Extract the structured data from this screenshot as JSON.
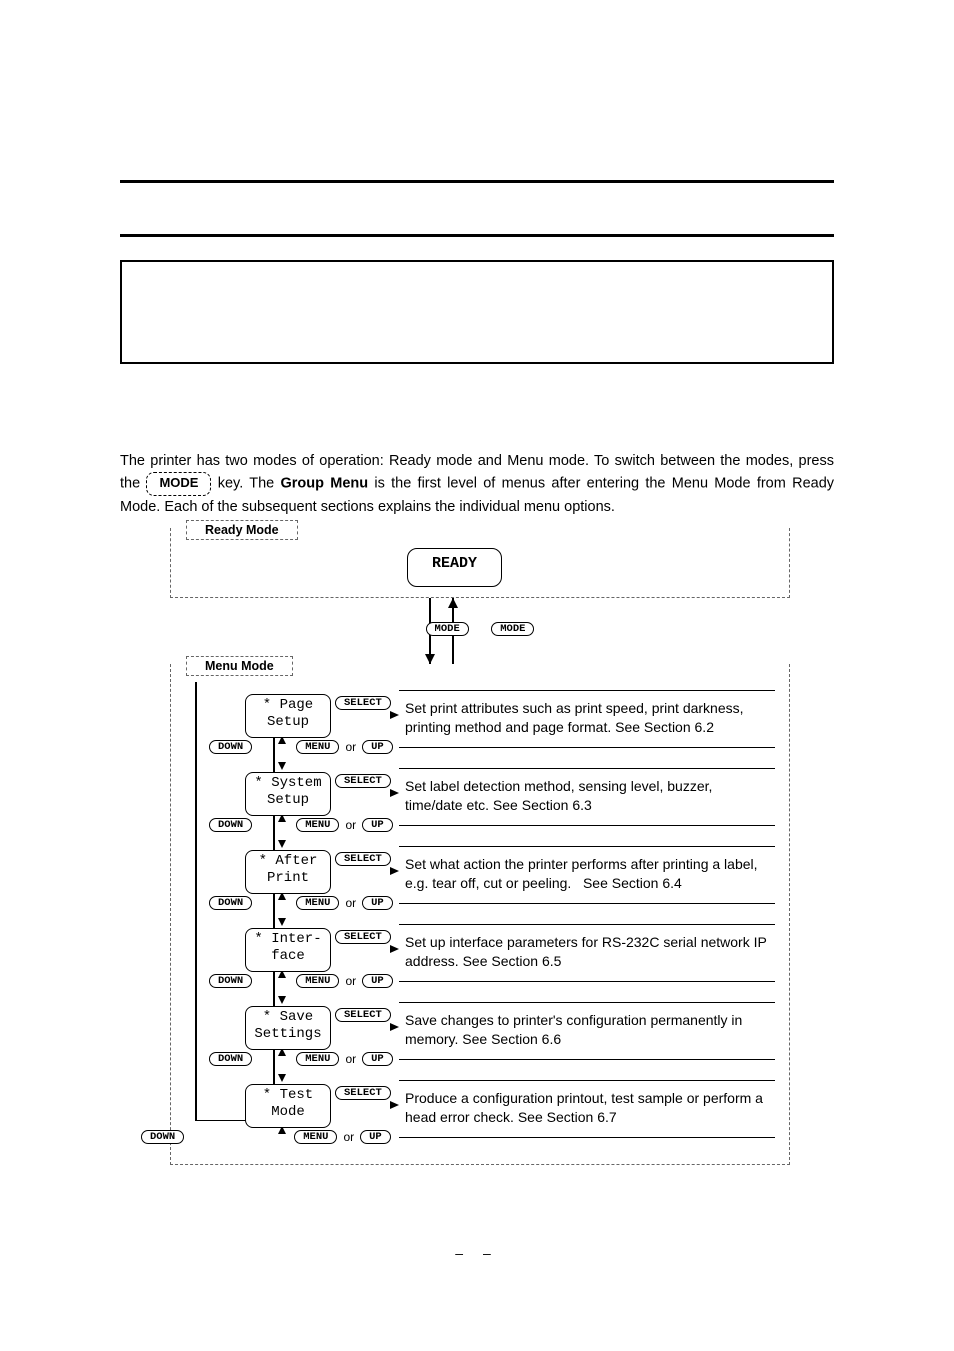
{
  "page": {
    "intro_part1": "The printer has two modes of operation: Ready mode and Menu mode. To switch between the modes, press the ",
    "intro_mode_key": "MODE",
    "intro_part2": " key. The ",
    "group_menu_strong": "Group Menu",
    "intro_part3": " is the first level of menus after entering the Menu Mode from Ready Mode. Each of the subsequent sections explains the individual menu options."
  },
  "diagram": {
    "ready_mode_label": "Ready Mode",
    "ready_lcd": "READY",
    "mode_key": "MODE",
    "menu_mode_label": "Menu Mode",
    "select_key": "SELECT",
    "down_key": "DOWN",
    "menu_key": "MENU",
    "up_key": "UP",
    "or": "or",
    "rows": [
      {
        "lcd_line1": "* Page",
        "lcd_line2": "Setup",
        "desc": "Set print attributes such as print speed, print darkness, printing method and page format. See Section 6.2"
      },
      {
        "lcd_line1": "* System",
        "lcd_line2": "Setup",
        "desc": "Set label detection method, sensing level, buzzer, time/date etc. See Section 6.3"
      },
      {
        "lcd_line1": "* After",
        "lcd_line2": "Print",
        "desc": "Set what action the printer performs after printing a label, e.g. tear off, cut or peeling.   See Section 6.4"
      },
      {
        "lcd_line1": "* Inter-",
        "lcd_line2": "face",
        "desc": "Set up interface parameters for RS-232C serial network IP address. See Section 6.5"
      },
      {
        "lcd_line1": "* Save",
        "lcd_line2": "Settings",
        "desc": "Save changes to printer's configuration permanently in memory. See Section 6.6"
      },
      {
        "lcd_line1": "* Test",
        "lcd_line2": "Mode",
        "desc": "Produce a configuration printout, test sample or perform a head error check. See Section 6.7"
      }
    ]
  },
  "footer_dash": "–   –"
}
